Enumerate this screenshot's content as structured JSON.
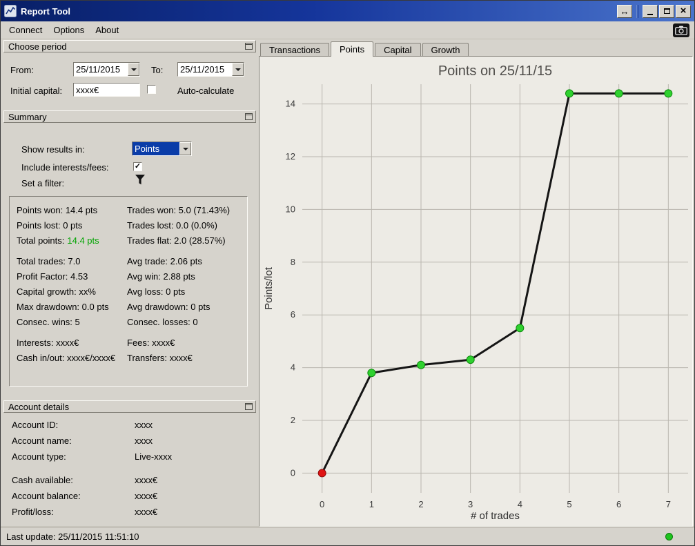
{
  "window": {
    "title": "Report Tool"
  },
  "icons": {
    "detach": "↔",
    "close": "×",
    "check": "✓"
  },
  "menu": {
    "connect": "Connect",
    "options": "Options",
    "about": "About"
  },
  "panels": {
    "choose_period": {
      "title": "Choose period",
      "from_label": "From:",
      "from_value": "25/11/2015",
      "to_label": "To:",
      "to_value": "25/11/2015",
      "initial_capital_label": "Initial capital:",
      "initial_capital_value": "xxxx€",
      "auto_calculate_label": "Auto-calculate"
    },
    "summary": {
      "title": "Summary",
      "show_results_label": "Show results in:",
      "show_results_value": "Points",
      "include_label": "Include interests/fees:",
      "filter_label": "Set a filter:",
      "stats": {
        "points_won": "Points won: 14.4 pts",
        "trades_won": "Trades won: 5.0 (71.43%)",
        "points_lost": "Points lost: 0 pts",
        "trades_lost": "Trades lost: 0.0 (0.0%)",
        "total_points_label": "Total points:",
        "total_points_value": "14.4 pts",
        "trades_flat": "Trades flat: 2.0 (28.57%)",
        "total_trades": "Total trades: 7.0",
        "avg_trade": "Avg trade: 2.06 pts",
        "profit_factor": "Profit Factor: 4.53",
        "avg_win": "Avg win: 2.88 pts",
        "capital_growth": "Capital growth: xx%",
        "avg_loss": "Avg loss: 0 pts",
        "max_drawdown": "Max drawdown: 0.0 pts",
        "avg_drawdown": "Avg drawdown: 0 pts",
        "consec_wins": "Consec. wins: 5",
        "consec_losses": "Consec. losses: 0",
        "interests": "Interests: xxxx€",
        "fees": "Fees: xxxx€",
        "cash_in_out": "Cash in/out: xxxx€/xxxx€",
        "transfers": "Transfers: xxxx€"
      }
    },
    "account_details": {
      "title": "Account details",
      "rows": [
        {
          "label": "Account ID:",
          "value": "xxxx"
        },
        {
          "label": "Account name:",
          "value": "xxxx"
        },
        {
          "label": "Account type:",
          "value": "Live-xxxx"
        },
        {
          "label": "Cash available:",
          "value": "xxxx€"
        },
        {
          "label": "Account balance:",
          "value": "xxxx€"
        },
        {
          "label": "Profit/loss:",
          "value": "xxxx€"
        }
      ]
    }
  },
  "status_bar": {
    "last_update": "Last update: 25/11/2015 11:51:10"
  },
  "tabs": [
    {
      "label": "Transactions",
      "active": false
    },
    {
      "label": "Points",
      "active": true
    },
    {
      "label": "Capital",
      "active": false
    },
    {
      "label": "Growth",
      "active": false
    }
  ],
  "chart_data": {
    "type": "line",
    "title": "Points on 25/11/15",
    "xlabel": "# of trades",
    "ylabel": "Points/lot",
    "x": [
      0,
      1,
      2,
      3,
      4,
      5,
      6,
      7
    ],
    "y": [
      0,
      3.8,
      4.1,
      4.3,
      5.5,
      14.4,
      14.4,
      14.4
    ],
    "xticks": [
      0,
      1,
      2,
      3,
      4,
      5,
      6,
      7
    ],
    "yticks": [
      0,
      2,
      4,
      6,
      8,
      10,
      12,
      14
    ],
    "xlim": [
      -0.4,
      7.4
    ],
    "ylim": [
      -0.75,
      14.75
    ],
    "grid": true,
    "line_color": "#151515",
    "grid_color": "#b9b6ae",
    "background": "#edebe5",
    "marker_fill": [
      "#e01414",
      "#2fd12f",
      "#2fd12f",
      "#2fd12f",
      "#2fd12f",
      "#2fd12f",
      "#2fd12f",
      "#2fd12f"
    ],
    "marker_stroke": [
      "#8f0b0b",
      "#0e8a0e",
      "#0e8a0e",
      "#0e8a0e",
      "#0e8a0e",
      "#0e8a0e",
      "#0e8a0e",
      "#0e8a0e"
    ]
  }
}
